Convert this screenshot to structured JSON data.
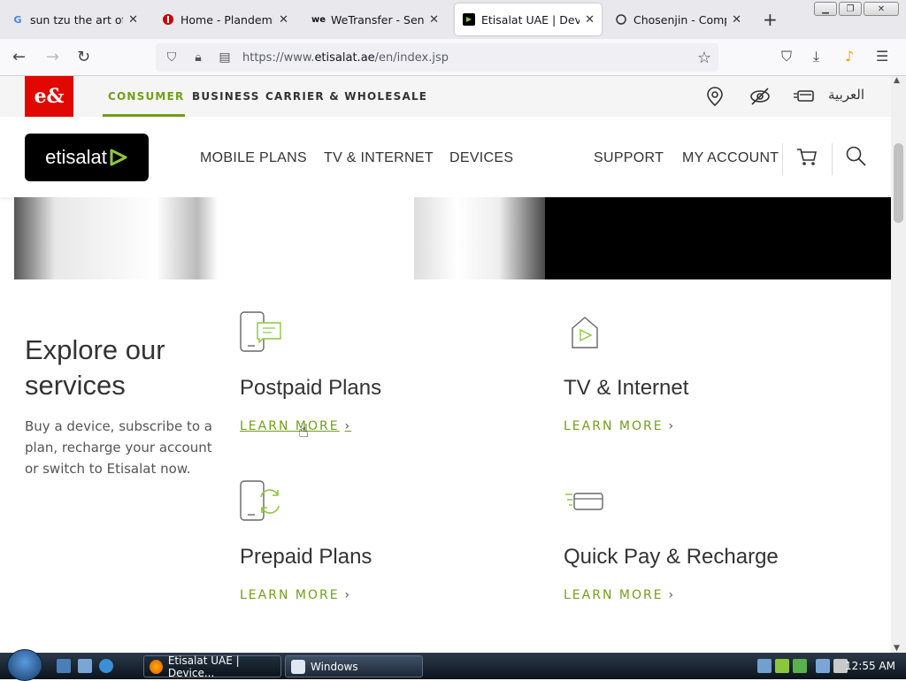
{
  "browser": {
    "tabs": [
      {
        "title": "sun tzu the art of war",
        "favicon": "google-icon",
        "close": "✕"
      },
      {
        "title": "Home - Plandemic",
        "favicon": "plandemic-icon",
        "close": "✕"
      },
      {
        "title": "WeTransfer - Send La",
        "favicon": "wetransfer-icon",
        "close": "✕"
      },
      {
        "title": "Etisalat UAE | Devices,",
        "favicon": "etisalat-icon",
        "close": "✕"
      },
      {
        "title": "Chosenjin - Compute",
        "favicon": "chosenjin-icon",
        "close": "✕"
      }
    ],
    "new_tab": "+",
    "url_prefix": "https://www.",
    "url_host": "etisalat.ae",
    "url_path": "/en/index.jsp"
  },
  "site": {
    "brand_mark": "e&",
    "segments": [
      "CONSUMER",
      "BUSINESS",
      "CARRIER & WHOLESALE"
    ],
    "arabic": "العربية",
    "logo_text": "etisalat",
    "main_nav": [
      "MOBILE PLANS",
      "TV & INTERNET",
      "DEVICES"
    ],
    "right_nav": [
      "SUPPORT",
      "MY ACCOUNT"
    ],
    "accent_color": "#719e19"
  },
  "explore": {
    "title": "Explore our services",
    "description": "Buy a device, subscribe to a plan, recharge your account or switch to Etisalat now."
  },
  "services": [
    {
      "title": "Postpaid Plans",
      "link": "LEARN MORE",
      "icon": "postpaid-phone-icon"
    },
    {
      "title": "TV & Internet",
      "link": "LEARN MORE",
      "icon": "home-play-icon"
    },
    {
      "title": "Prepaid Plans",
      "link": "LEARN MORE",
      "icon": "prepaid-phone-icon"
    },
    {
      "title": "Quick Pay & Recharge",
      "link": "LEARN MORE",
      "icon": "card-pay-icon"
    }
  ],
  "taskbar": {
    "buttons": [
      "Etisalat UAE | Device...",
      "Windows"
    ],
    "clock": "12:55 AM"
  }
}
